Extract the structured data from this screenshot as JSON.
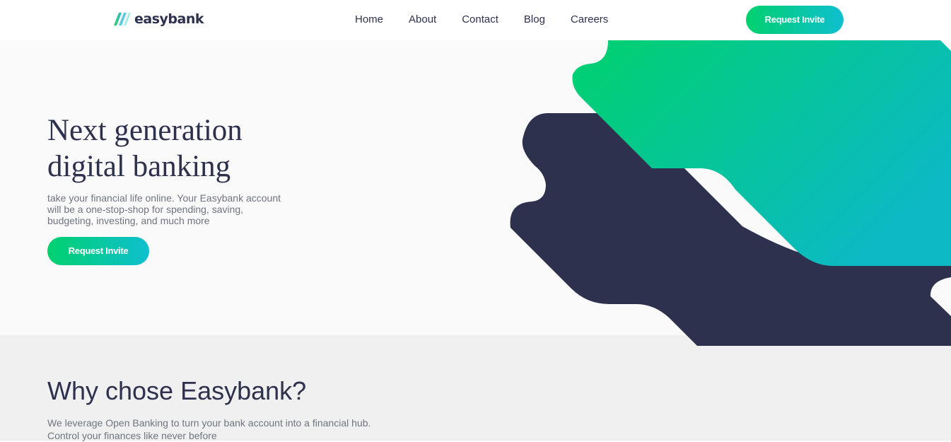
{
  "brand": {
    "name": "easybank"
  },
  "nav": {
    "links": [
      "Home",
      "About",
      "Contact",
      "Blog",
      "Careers"
    ],
    "cta": "Request Invite"
  },
  "hero": {
    "title_line1": "Next generation",
    "title_line2": "digital banking",
    "description": "take your financial life online. Your Easybank account will be a one-stop-shop for spending, saving, budgeting, investing, and much more",
    "cta": "Request Invite"
  },
  "why": {
    "title": "Why chose Easybank?",
    "description": "We leverage Open Banking to turn your bank account into a financial hub. Control your finances like never before"
  },
  "colors": {
    "dark_blue": "#2d314d",
    "lime_green": "#00d16e",
    "bright_cyan": "#0fbfcf",
    "grayish_blue": "#707480",
    "light_gray": "#fafafa"
  },
  "icons": {
    "logo": "easybank-logo-icon"
  }
}
